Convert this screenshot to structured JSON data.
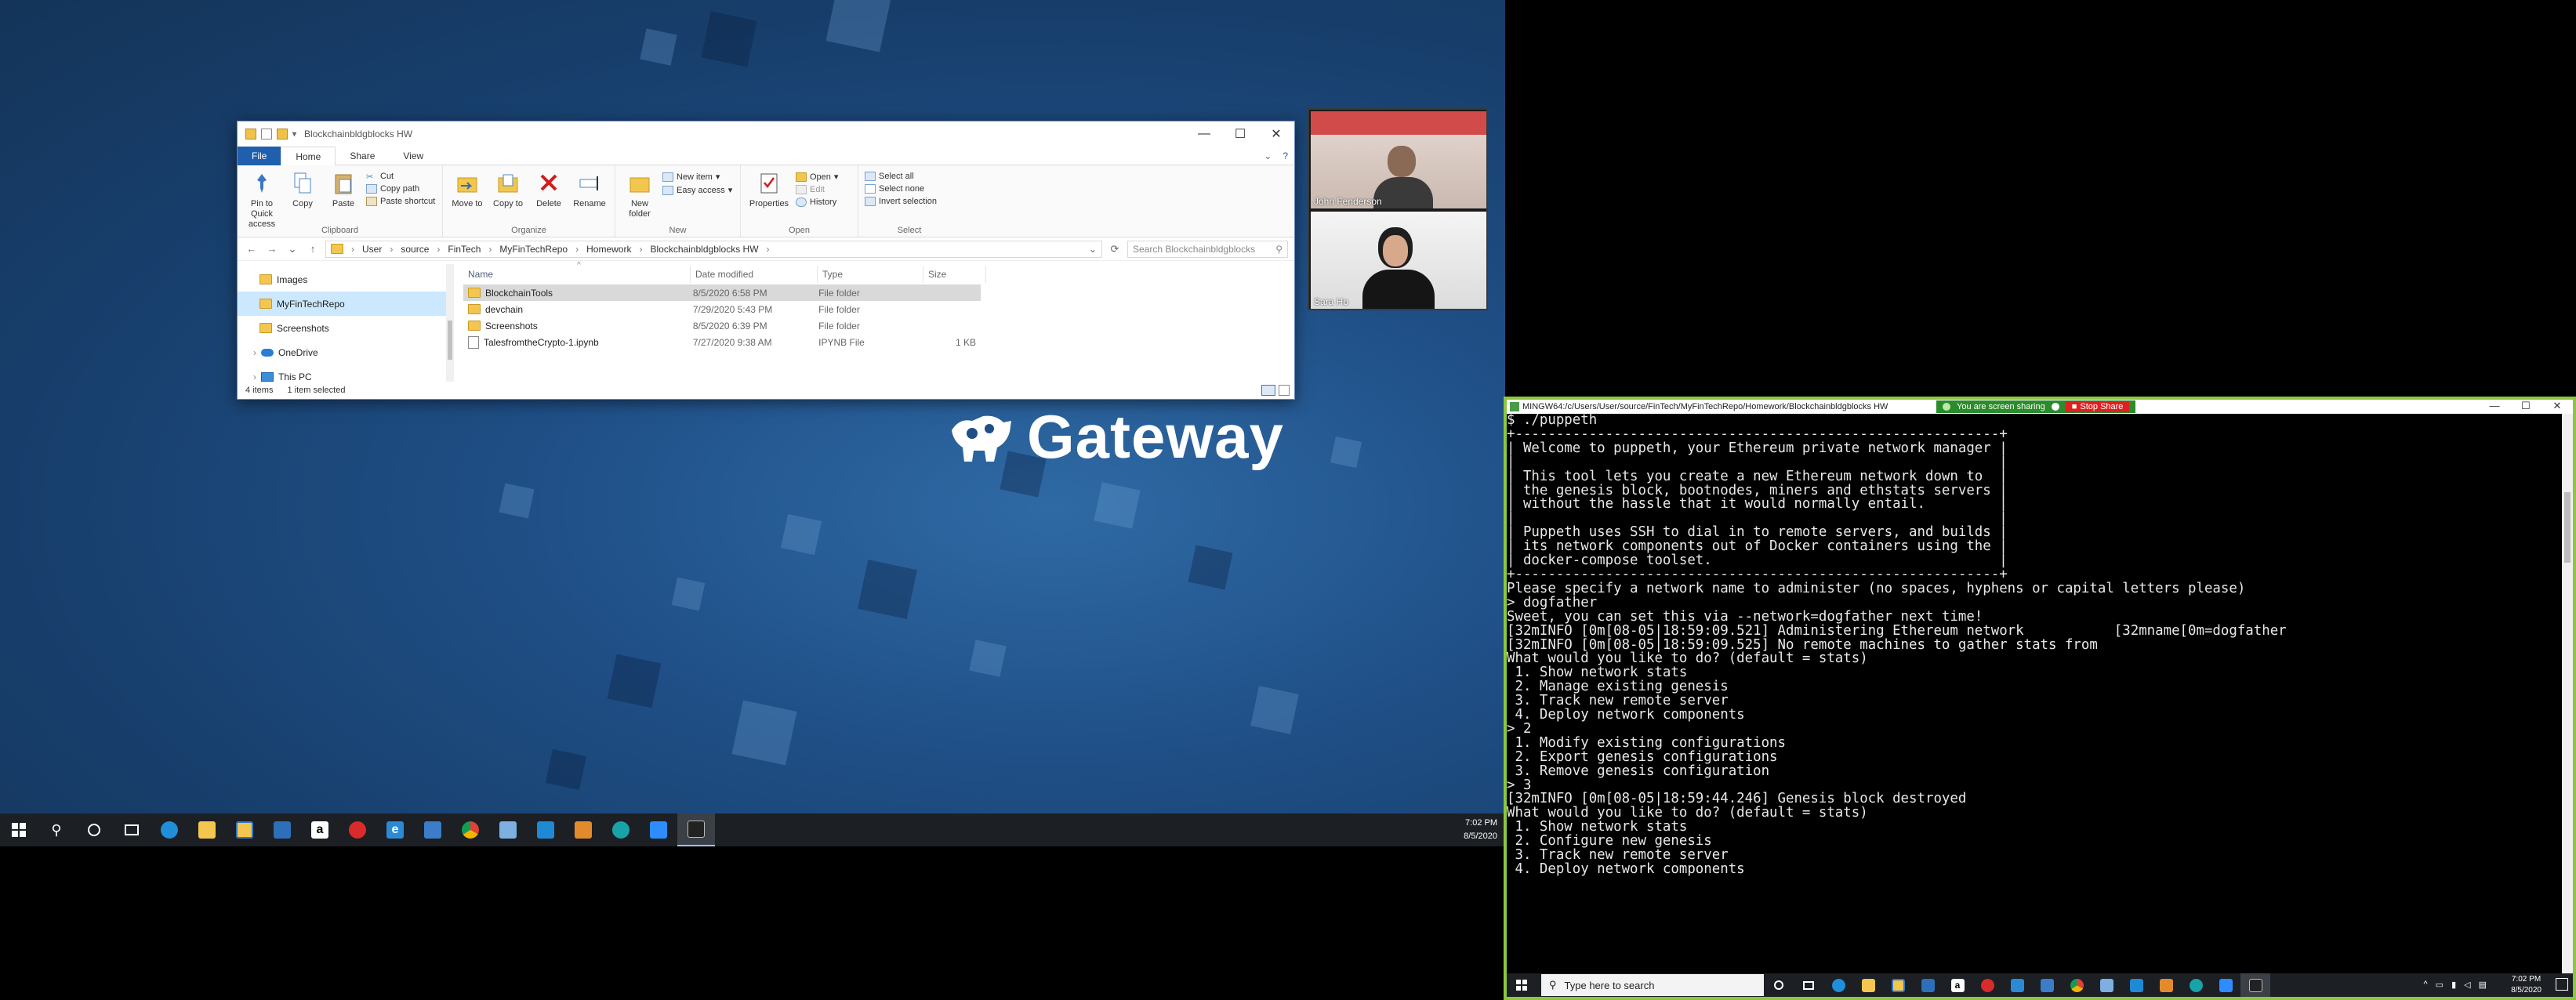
{
  "explorer": {
    "title": "Blockchainbldgblocks HW",
    "tabs": [
      "File",
      "Home",
      "Share",
      "View"
    ],
    "clipboard": {
      "label": "Clipboard",
      "pin": "Pin to Quick access",
      "copy": "Copy",
      "paste": "Paste",
      "cut": "Cut",
      "copy_path": "Copy path",
      "paste_shortcut": "Paste shortcut"
    },
    "organize": {
      "label": "Organize",
      "move_to": "Move to",
      "copy_to": "Copy to",
      "delete": "Delete",
      "rename": "Rename"
    },
    "new": {
      "label": "New",
      "new_folder": "New folder",
      "new_item": "New item",
      "easy_access": "Easy access"
    },
    "open": {
      "label": "Open",
      "properties": "Properties",
      "open": "Open",
      "edit": "Edit",
      "history": "History"
    },
    "select": {
      "label": "Select",
      "select_all": "Select all",
      "select_none": "Select none",
      "invert": "Invert selection"
    },
    "breadcrumb": [
      "User",
      "source",
      "FinTech",
      "MyFinTechRepo",
      "Homework",
      "Blockchainbldgblocks HW"
    ],
    "search_placeholder": "Search Blockchainbldgblocks",
    "nav": [
      {
        "label": "Images",
        "icon": "folder-icon"
      },
      {
        "label": "MyFinTechRepo",
        "icon": "folder-icon"
      },
      {
        "label": "Screenshots",
        "icon": "folder-icon"
      },
      {
        "label": "OneDrive",
        "icon": "cloud-icon"
      },
      {
        "label": "This PC",
        "icon": "pc-icon"
      }
    ],
    "columns": [
      "Name",
      "Date modified",
      "Type",
      "Size"
    ],
    "files": [
      {
        "name": "BlockchainTools",
        "date": "8/5/2020 6:58 PM",
        "type": "File folder",
        "size": ""
      },
      {
        "name": "devchain",
        "date": "7/29/2020 5:43 PM",
        "type": "File folder",
        "size": ""
      },
      {
        "name": "Screenshots",
        "date": "8/5/2020 6:39 PM",
        "type": "File folder",
        "size": ""
      },
      {
        "name": "TalesfromtheCrypto-1.ipynb",
        "date": "7/27/2020 9:38 AM",
        "type": "IPYNB File",
        "size": "1 KB"
      }
    ],
    "status_items": "4 items",
    "status_selected": "1 item selected"
  },
  "desktop": {
    "brand": "Gateway"
  },
  "zoom": {
    "participants": [
      "John Fenderson",
      "Sara Ho"
    ]
  },
  "left_taskbar": {
    "time": "7:02 PM",
    "date": "8/5/2020",
    "icons": [
      "windows-start-icon",
      "search-icon",
      "cortana-icon",
      "task-view-icon",
      "edge-icon",
      "file-explorer-icon",
      "store-icon",
      "app-icon",
      "amazon-icon",
      "media-icon",
      "edge-old-icon",
      "mail-icon",
      "chrome-icon",
      "notepad-icon",
      "vscode-icon",
      "sublime-icon",
      "app2-icon",
      "zoom-icon",
      "terminal-icon"
    ]
  },
  "terminal": {
    "title": "MINGW64:/c/Users/User/source/FinTech/MyFinTechRepo/Homework/Blockchainbldgblocks HW",
    "sharing_label": "You are screen sharing",
    "stop_share": "Stop Share",
    "lines": [
      "$ ./puppeth",
      "+-----------------------------------------------------------+",
      "| Welcome to puppeth, your Ethereum private network manager |",
      "|                                                           |",
      "| This tool lets you create a new Ethereum network down to  |",
      "| the genesis block, bootnodes, miners and ethstats servers |",
      "| without the hassle that it would normally entail.         |",
      "|                                                           |",
      "| Puppeth uses SSH to dial in to remote servers, and builds |",
      "| its network components out of Docker containers using the |",
      "| docker-compose toolset.                                   |",
      "+-----------------------------------------------------------+",
      "",
      "Please specify a network name to administer (no spaces, hyphens or capital letters please)",
      "> dogfather",
      "",
      "Sweet, you can set this via --network=dogfather next time!",
      "",
      "\u001b[32mINFO \u001b[0m[08-05|18:59:09.521] Administering Ethereum network           \u001b[32mname\u001b[0m=dogfather",
      "\u001b[32mINFO \u001b[0m[08-05|18:59:09.525] No remote machines to gather stats from",
      "",
      "What would you like to do? (default = stats)",
      " 1. Show network stats",
      " 2. Manage existing genesis",
      " 3. Track new remote server",
      " 4. Deploy network components",
      "> 2",
      "",
      " 1. Modify existing configurations",
      " 2. Export genesis configurations",
      " 3. Remove genesis configuration",
      "> 3",
      "\u001b[32mINFO \u001b[0m[08-05|18:59:44.246] Genesis block destroyed",
      "",
      "What would you like to do? (default = stats)",
      " 1. Show network stats",
      " 2. Configure new genesis",
      " 3. Track new remote server",
      " 4. Deploy network components"
    ],
    "display_lines": [
      "$ ./puppeth",
      "+-----------------------------------------------------------+",
      "| Welcome to puppeth, your Ethereum private network manager |",
      "|                                                           |",
      "| This tool lets you create a new Ethereum network down to  |",
      "| the genesis block, bootnodes, miners and ethstats servers |",
      "| without the hassle that it would normally entail.         |",
      "|                                                           |",
      "| Puppeth uses SSH to dial in to remote servers, and builds |",
      "| its network components out of Docker containers using the |",
      "| docker-compose toolset.                                   |",
      "+-----------------------------------------------------------+",
      "",
      "Please specify a network name to administer (no spaces, hyphens or capital letters please)",
      "> dogfather",
      "",
      "Sweet, you can set this via --network=dogfather next time!",
      "",
      "[32mINFO [0m[08-05|18:59:09.521] Administering Ethereum network           [32mname[0m=dogfather",
      "[32mINFO [0m[08-05|18:59:09.525] No remote machines to gather stats from",
      "",
      "What would you like to do? (default = stats)",
      " 1. Show network stats",
      " 2. Manage existing genesis",
      " 3. Track new remote server",
      " 4. Deploy network components",
      "> 2",
      "",
      " 1. Modify existing configurations",
      " 2. Export genesis configurations",
      " 3. Remove genesis configuration",
      "> 3",
      "[32mINFO [0m[08-05|18:59:44.246] Genesis block destroyed",
      "",
      "What would you like to do? (default = stats)",
      " 1. Show network stats",
      " 2. Configure new genesis",
      " 3. Track new remote server",
      " 4. Deploy network components"
    ]
  },
  "right_taskbar": {
    "search_placeholder": "Type here to search",
    "time": "7:02 PM",
    "date": "8/5/2020"
  },
  "colors": {
    "share_border": "#8dc63f",
    "explorer_accent": "#1f5fae",
    "stop_share": "#e02020"
  }
}
